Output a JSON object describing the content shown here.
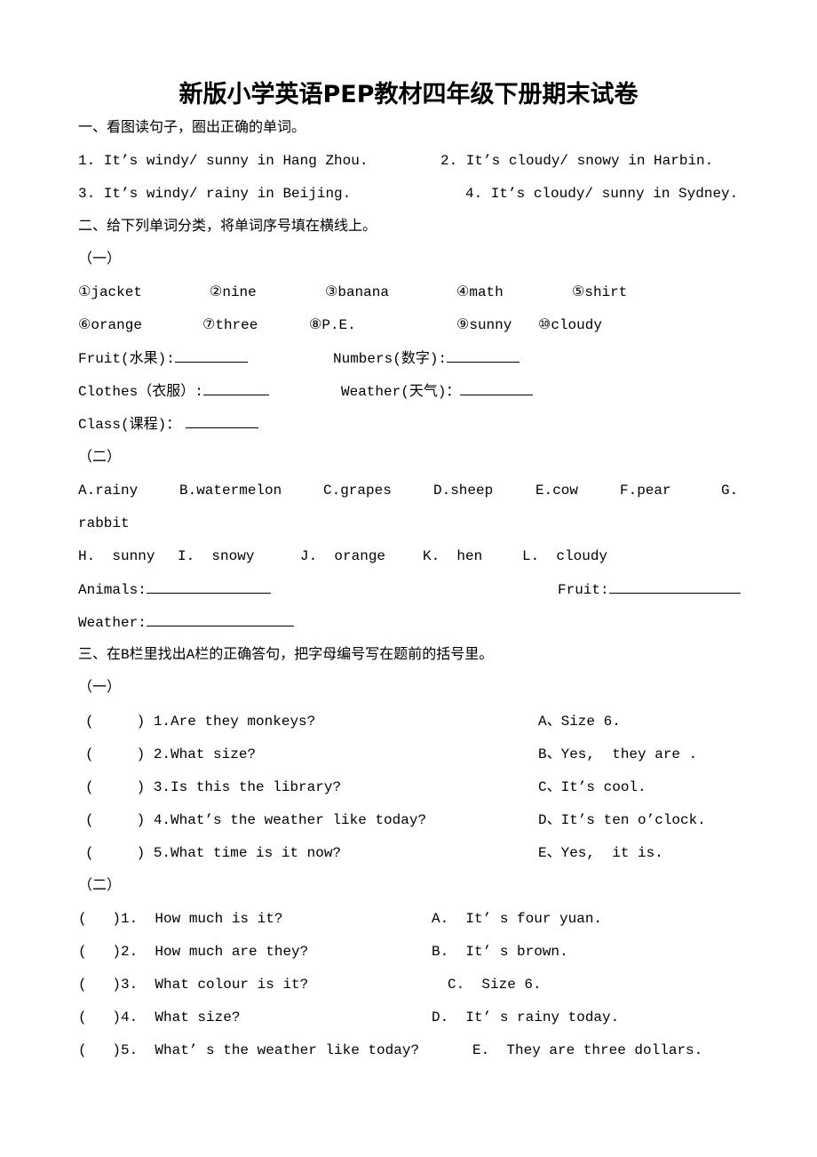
{
  "title": "新版小学英语PEP教材四年级下册期末试卷",
  "section1": {
    "heading": "一、看图读句子，圈出正确的单词。",
    "items": [
      "1. It’s windy/ sunny in Hang Zhou.",
      "2. It’s cloudy/ snowy in Harbin.",
      "3. It’s windy/ rainy in Beijing.",
      "4. It’s cloudy/ sunny in Sydney."
    ]
  },
  "section2": {
    "heading": "二、给下列单词分类，将单词序号填在横线上。",
    "part1": {
      "label": "（一）",
      "words": [
        "①jacket",
        "②nine",
        "③banana",
        "④math",
        "⑤shirt",
        "⑥orange",
        "⑦three",
        "⑧P.E.",
        "⑨sunny",
        "⑩cloudy"
      ],
      "categories": [
        "Fruit(水果):",
        "Numbers(数字):",
        "Clothes（衣服）:",
        "Weather(天气)：",
        "Class(课程)："
      ]
    },
    "part2": {
      "label": "（二）",
      "words": [
        "A.rainy",
        "B.watermelon",
        "C.grapes",
        "D.sheep",
        "E.cow",
        "F.pear",
        "G.",
        "rabbit",
        "H.  sunny",
        "I.  snowy",
        "J.  orange",
        "K.  hen",
        "L.  cloudy"
      ],
      "categories": [
        "Animals:",
        "Fruit:",
        "Weather:"
      ]
    }
  },
  "section3": {
    "heading": "三、在B栏里找出A栏的正确答句，把字母编号写在题前的括号里。",
    "part1": {
      "label": "（一）",
      "questions": [
        "(     ) 1.Are they monkeys?",
        "(     ) 2.What size?",
        "(     ) 3.Is this the library?",
        "(     ) 4.What’s the weather like today?",
        "(     ) 5.What time is it now?"
      ],
      "answers": [
        "A、Size 6.",
        "B、Yes,  they are .",
        "C、It’s cool.",
        "D、It’s ten o’clock.",
        "E、Yes,  it is."
      ]
    },
    "part2": {
      "label": "（二）",
      "questions": [
        "(   )1.  How much is it?",
        "(   )2.  How much are they?",
        "(   )3.  What colour is it?",
        "(   )4.  What size?",
        "(   )5.  What’ s the weather like today?"
      ],
      "answers": [
        "A.  It’ s four yuan.",
        "B.  It’ s brown.",
        "C.  Size 6.",
        "D.  It’ s rainy today.",
        "E.  They are three dollars."
      ]
    }
  }
}
